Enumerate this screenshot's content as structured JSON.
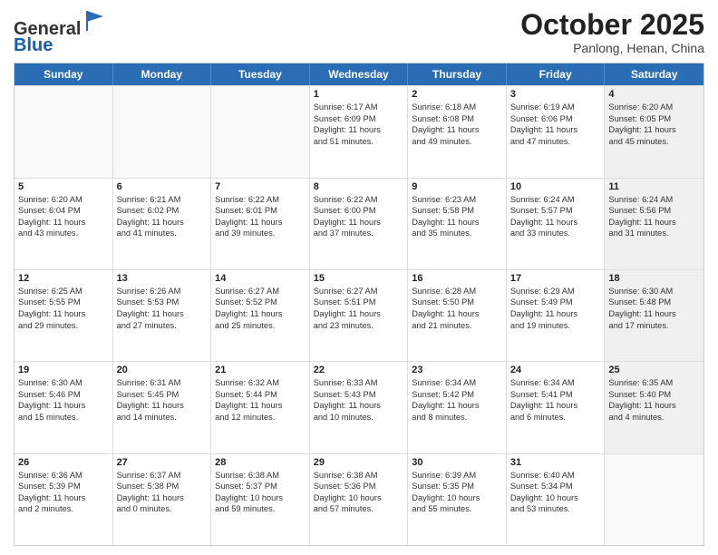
{
  "header": {
    "logo_general": "General",
    "logo_blue": "Blue",
    "month_title": "October 2025",
    "location": "Panlong, Henan, China"
  },
  "weekdays": [
    "Sunday",
    "Monday",
    "Tuesday",
    "Wednesday",
    "Thursday",
    "Friday",
    "Saturday"
  ],
  "rows": [
    [
      {
        "day": "",
        "lines": [],
        "empty": true
      },
      {
        "day": "",
        "lines": [],
        "empty": true
      },
      {
        "day": "",
        "lines": [],
        "empty": true
      },
      {
        "day": "1",
        "lines": [
          "Sunrise: 6:17 AM",
          "Sunset: 6:09 PM",
          "Daylight: 11 hours",
          "and 51 minutes."
        ]
      },
      {
        "day": "2",
        "lines": [
          "Sunrise: 6:18 AM",
          "Sunset: 6:08 PM",
          "Daylight: 11 hours",
          "and 49 minutes."
        ]
      },
      {
        "day": "3",
        "lines": [
          "Sunrise: 6:19 AM",
          "Sunset: 6:06 PM",
          "Daylight: 11 hours",
          "and 47 minutes."
        ]
      },
      {
        "day": "4",
        "lines": [
          "Sunrise: 6:20 AM",
          "Sunset: 6:05 PM",
          "Daylight: 11 hours",
          "and 45 minutes."
        ]
      }
    ],
    [
      {
        "day": "5",
        "lines": [
          "Sunrise: 6:20 AM",
          "Sunset: 6:04 PM",
          "Daylight: 11 hours",
          "and 43 minutes."
        ]
      },
      {
        "day": "6",
        "lines": [
          "Sunrise: 6:21 AM",
          "Sunset: 6:02 PM",
          "Daylight: 11 hours",
          "and 41 minutes."
        ]
      },
      {
        "day": "7",
        "lines": [
          "Sunrise: 6:22 AM",
          "Sunset: 6:01 PM",
          "Daylight: 11 hours",
          "and 39 minutes."
        ]
      },
      {
        "day": "8",
        "lines": [
          "Sunrise: 6:22 AM",
          "Sunset: 6:00 PM",
          "Daylight: 11 hours",
          "and 37 minutes."
        ]
      },
      {
        "day": "9",
        "lines": [
          "Sunrise: 6:23 AM",
          "Sunset: 5:58 PM",
          "Daylight: 11 hours",
          "and 35 minutes."
        ]
      },
      {
        "day": "10",
        "lines": [
          "Sunrise: 6:24 AM",
          "Sunset: 5:57 PM",
          "Daylight: 11 hours",
          "and 33 minutes."
        ]
      },
      {
        "day": "11",
        "lines": [
          "Sunrise: 6:24 AM",
          "Sunset: 5:56 PM",
          "Daylight: 11 hours",
          "and 31 minutes."
        ]
      }
    ],
    [
      {
        "day": "12",
        "lines": [
          "Sunrise: 6:25 AM",
          "Sunset: 5:55 PM",
          "Daylight: 11 hours",
          "and 29 minutes."
        ]
      },
      {
        "day": "13",
        "lines": [
          "Sunrise: 6:26 AM",
          "Sunset: 5:53 PM",
          "Daylight: 11 hours",
          "and 27 minutes."
        ]
      },
      {
        "day": "14",
        "lines": [
          "Sunrise: 6:27 AM",
          "Sunset: 5:52 PM",
          "Daylight: 11 hours",
          "and 25 minutes."
        ]
      },
      {
        "day": "15",
        "lines": [
          "Sunrise: 6:27 AM",
          "Sunset: 5:51 PM",
          "Daylight: 11 hours",
          "and 23 minutes."
        ]
      },
      {
        "day": "16",
        "lines": [
          "Sunrise: 6:28 AM",
          "Sunset: 5:50 PM",
          "Daylight: 11 hours",
          "and 21 minutes."
        ]
      },
      {
        "day": "17",
        "lines": [
          "Sunrise: 6:29 AM",
          "Sunset: 5:49 PM",
          "Daylight: 11 hours",
          "and 19 minutes."
        ]
      },
      {
        "day": "18",
        "lines": [
          "Sunrise: 6:30 AM",
          "Sunset: 5:48 PM",
          "Daylight: 11 hours",
          "and 17 minutes."
        ]
      }
    ],
    [
      {
        "day": "19",
        "lines": [
          "Sunrise: 6:30 AM",
          "Sunset: 5:46 PM",
          "Daylight: 11 hours",
          "and 15 minutes."
        ]
      },
      {
        "day": "20",
        "lines": [
          "Sunrise: 6:31 AM",
          "Sunset: 5:45 PM",
          "Daylight: 11 hours",
          "and 14 minutes."
        ]
      },
      {
        "day": "21",
        "lines": [
          "Sunrise: 6:32 AM",
          "Sunset: 5:44 PM",
          "Daylight: 11 hours",
          "and 12 minutes."
        ]
      },
      {
        "day": "22",
        "lines": [
          "Sunrise: 6:33 AM",
          "Sunset: 5:43 PM",
          "Daylight: 11 hours",
          "and 10 minutes."
        ]
      },
      {
        "day": "23",
        "lines": [
          "Sunrise: 6:34 AM",
          "Sunset: 5:42 PM",
          "Daylight: 11 hours",
          "and 8 minutes."
        ]
      },
      {
        "day": "24",
        "lines": [
          "Sunrise: 6:34 AM",
          "Sunset: 5:41 PM",
          "Daylight: 11 hours",
          "and 6 minutes."
        ]
      },
      {
        "day": "25",
        "lines": [
          "Sunrise: 6:35 AM",
          "Sunset: 5:40 PM",
          "Daylight: 11 hours",
          "and 4 minutes."
        ]
      }
    ],
    [
      {
        "day": "26",
        "lines": [
          "Sunrise: 6:36 AM",
          "Sunset: 5:39 PM",
          "Daylight: 11 hours",
          "and 2 minutes."
        ]
      },
      {
        "day": "27",
        "lines": [
          "Sunrise: 6:37 AM",
          "Sunset: 5:38 PM",
          "Daylight: 11 hours",
          "and 0 minutes."
        ]
      },
      {
        "day": "28",
        "lines": [
          "Sunrise: 6:38 AM",
          "Sunset: 5:37 PM",
          "Daylight: 10 hours",
          "and 59 minutes."
        ]
      },
      {
        "day": "29",
        "lines": [
          "Sunrise: 6:38 AM",
          "Sunset: 5:36 PM",
          "Daylight: 10 hours",
          "and 57 minutes."
        ]
      },
      {
        "day": "30",
        "lines": [
          "Sunrise: 6:39 AM",
          "Sunset: 5:35 PM",
          "Daylight: 10 hours",
          "and 55 minutes."
        ]
      },
      {
        "day": "31",
        "lines": [
          "Sunrise: 6:40 AM",
          "Sunset: 5:34 PM",
          "Daylight: 10 hours",
          "and 53 minutes."
        ]
      },
      {
        "day": "",
        "lines": [],
        "empty": true
      }
    ]
  ]
}
